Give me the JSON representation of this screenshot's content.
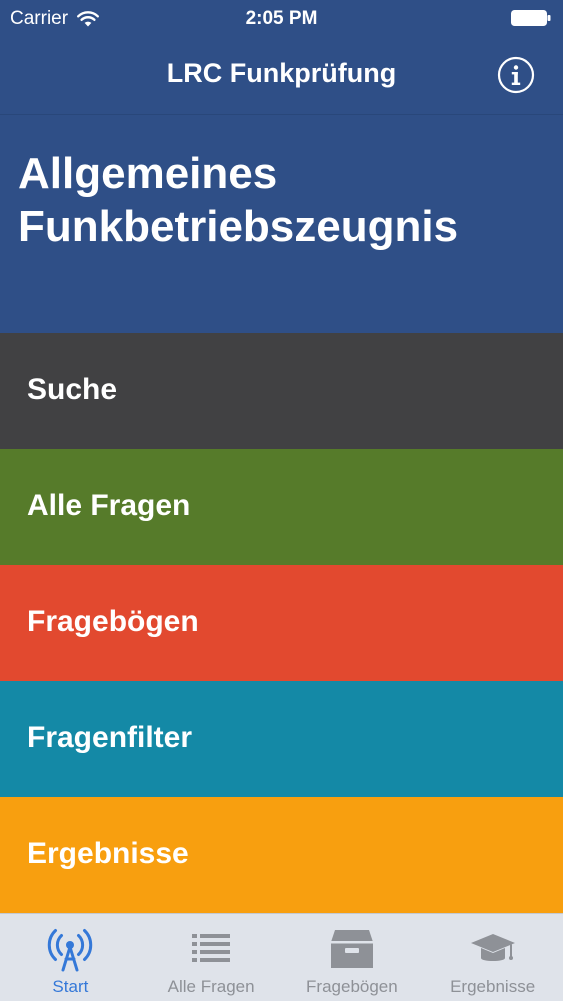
{
  "status_bar": {
    "carrier": "Carrier",
    "time": "2:05 PM"
  },
  "nav": {
    "title": "LRC Funkprüfung",
    "info_icon": "info-circle-icon"
  },
  "hero": {
    "title_line1": "Allgemeines",
    "title_line2": "Funkbetriebszeugnis"
  },
  "menu": {
    "items": [
      {
        "label": "Suche",
        "color": "#414143"
      },
      {
        "label": "Alle Fragen",
        "color": "#567b2a"
      },
      {
        "label": "Fragebögen",
        "color": "#e2492f"
      },
      {
        "label": "Fragenfilter",
        "color": "#1489a6"
      },
      {
        "label": "Ergebnisse",
        "color": "#f89f0f"
      }
    ]
  },
  "tabs": [
    {
      "label": "Start",
      "icon": "antenna-icon",
      "active": true
    },
    {
      "label": "Alle Fragen",
      "icon": "list-icon",
      "active": false
    },
    {
      "label": "Fragebögen",
      "icon": "archive-box-icon",
      "active": false
    },
    {
      "label": "Ergebnisse",
      "icon": "graduation-cap-icon",
      "active": false
    }
  ],
  "colors": {
    "brand_blue": "#2f4f87",
    "tab_active": "#3478d8",
    "tab_inactive": "#8e9197",
    "tab_bar_bg": "#dfe3ea"
  }
}
